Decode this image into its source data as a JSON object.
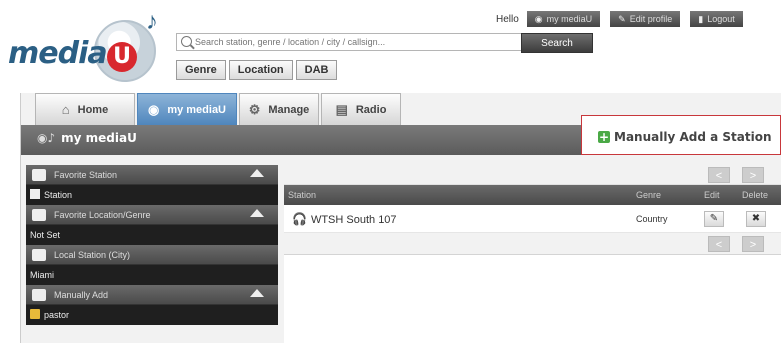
{
  "header": {
    "logo_text": "media",
    "logo_letter": "U",
    "hello": "Hello",
    "top_buttons": [
      {
        "label": "my mediaU",
        "icon": "mediau-icon"
      },
      {
        "label": "Edit profile",
        "icon": "pencil-icon"
      },
      {
        "label": "Logout",
        "icon": "logout-icon"
      }
    ],
    "search_placeholder": "Search station, genre / location / city / callsign...",
    "search_button": "Search",
    "subnav": [
      "Genre",
      "Location",
      "DAB"
    ]
  },
  "tabs": [
    {
      "label": "Home",
      "icon": "home-icon",
      "active": false
    },
    {
      "label": "my mediaU",
      "icon": "mediau-icon",
      "active": true
    },
    {
      "label": "Manage",
      "icon": "manage-icon",
      "active": false
    },
    {
      "label": "Radio",
      "icon": "radio-icon",
      "active": false
    }
  ],
  "titlebar": {
    "title": "my mediaU"
  },
  "manual_add": {
    "label": "Manually Add a Station"
  },
  "sidebar": {
    "favorite_station": {
      "header": "Favorite Station",
      "items": [
        "Station"
      ]
    },
    "favorite_location": {
      "header": "Favorite Location/Genre",
      "items": [
        "Not Set"
      ]
    },
    "local_station": {
      "header": "Local Station (City)",
      "items": [
        "Miami"
      ]
    },
    "manually_add": {
      "header": "Manually Add",
      "items": [
        "pastor"
      ]
    }
  },
  "table": {
    "columns": {
      "station": "Station",
      "genre": "Genre",
      "edit": "Edit",
      "delete": "Delete"
    },
    "rows": [
      {
        "station": "WTSH South 107",
        "genre": "Country"
      }
    ],
    "prev": "<",
    "next": ">"
  },
  "colors": {
    "active_tab": "#4f86bd",
    "highlight_border": "#c8373b",
    "add_icon": "#4aa946"
  }
}
